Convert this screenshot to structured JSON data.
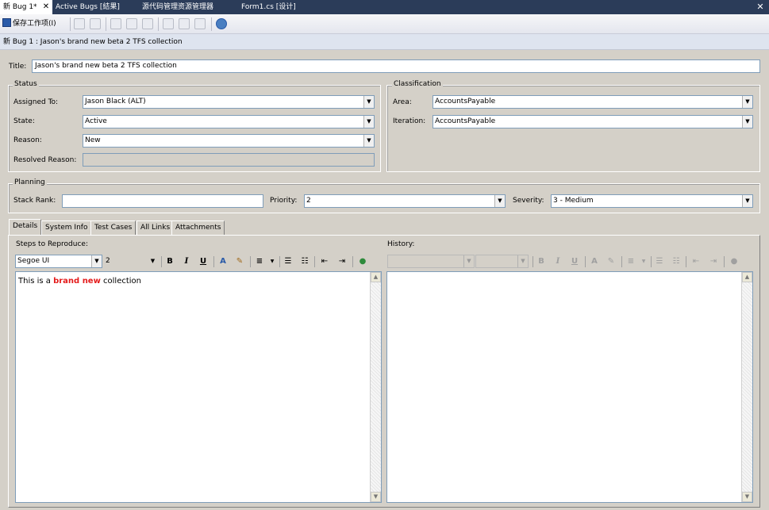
{
  "tabs": [
    {
      "label": "新 Bug 1*"
    },
    {
      "label": "Active Bugs [結果]"
    },
    {
      "label": "源代码管理资源管理器"
    },
    {
      "label": "Form1.cs [设计]"
    }
  ],
  "toolbar": {
    "save_label": "保存工作项(I)"
  },
  "breadcrumb": "新 Bug 1 : Jason's brand new beta 2 TFS collection",
  "title": {
    "label": "Title:",
    "value": "Jason's brand new beta 2 TFS collection"
  },
  "status": {
    "legend": "Status",
    "assigned_to": {
      "label": "Assigned To:",
      "value": "Jason Black (ALT)"
    },
    "state": {
      "label": "State:",
      "value": "Active"
    },
    "reason": {
      "label": "Reason:",
      "value": "New"
    },
    "resolved_reason": {
      "label": "Resolved Reason:",
      "value": ""
    }
  },
  "classification": {
    "legend": "Classification",
    "area": {
      "label": "Area:",
      "value": "AccountsPayable"
    },
    "iteration": {
      "label": "Iteration:",
      "value": "AccountsPayable"
    }
  },
  "planning": {
    "legend": "Planning",
    "stack_rank": {
      "label": "Stack Rank:",
      "value": ""
    },
    "priority": {
      "label": "Priority:",
      "value": "2"
    },
    "severity": {
      "label": "Severity:",
      "value": "3 - Medium"
    }
  },
  "detail_tabs": [
    "Details",
    "System Info",
    "Test Cases",
    "All Links",
    "Attachments"
  ],
  "steps": {
    "label": "Steps to Reproduce:",
    "font": "Segoe UI",
    "size": "2",
    "text_before": "This is a ",
    "text_bold": "brand new",
    "text_after": " collection"
  },
  "history": {
    "label": "History:"
  },
  "colors": {
    "tab_strip": "#2b3c59",
    "highlight_text": "#e41b1b",
    "panel": "#d4d0c8"
  }
}
